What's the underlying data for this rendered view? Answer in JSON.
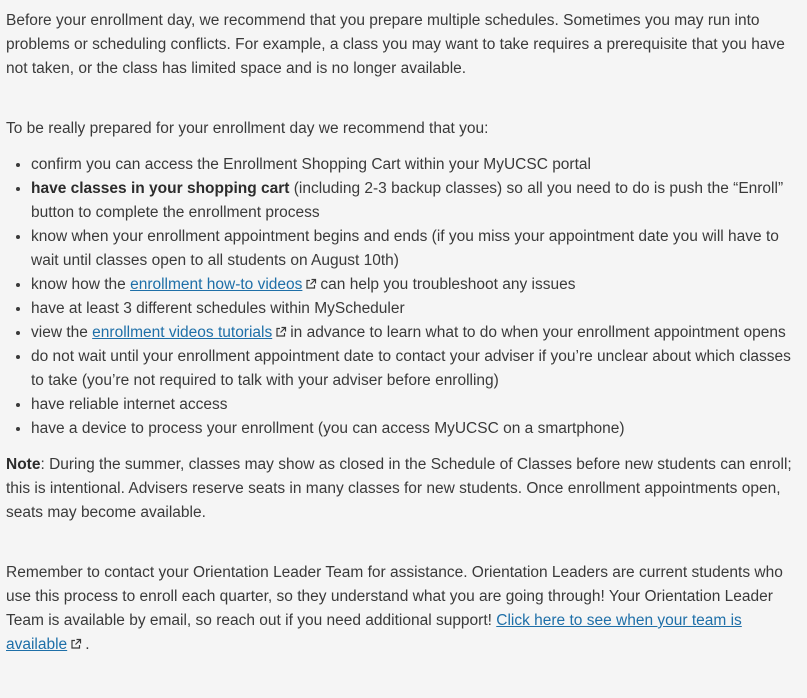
{
  "intro": "Before your enrollment day, we recommend that you prepare multiple schedules. Sometimes you may run into problems or scheduling conflicts. For example, a class you may want to take requires a prerequisite that you have not taken, or the class has limited space and is no longer available.",
  "lead_in": "To be really prepared for your enrollment day we recommend that you:",
  "list": {
    "item1": "confirm you can access the Enrollment Shopping Cart within your MyUCSC portal",
    "item2_bold": "have classes in your shopping cart",
    "item2_rest": " (including 2-3 backup classes) so all you need to do is push the “Enroll” button to complete the enrollment process",
    "item3": "know when your enrollment appointment begins and ends (if you miss your appointment date you will have to wait until classes open to all students on August 10th)",
    "item4_before": "know how the ",
    "item4_link": "enrollment how-to videos",
    "item4_after": "can help you troubleshoot any issues",
    "item5": "have at least 3 different schedules within MyScheduler",
    "item6_before": "view the ",
    "item6_link": "enrollment videos tutorials",
    "item6_after": "in advance to learn what to do when your enrollment appointment opens",
    "item7": "do not wait until your enrollment appointment date to contact your adviser if you’re unclear about which classes to take (you’re not required to talk with your adviser before enrolling)",
    "item8": "have reliable internet access",
    "item9": "have a device to process your enrollment (you can access MyUCSC on a smartphone)"
  },
  "note": {
    "label": "Note",
    "text": ": During the summer, classes may show as closed in the Schedule of Classes before new students can enroll; this is intentional. Advisers reserve seats in many classes for new students. Once enrollment appointments open, seats may become available."
  },
  "closing": {
    "text": "Remember to contact your Orientation Leader Team for assistance. Orientation Leaders are current students who use this process to enroll each quarter, so they understand what you are going through! Your Orientation Leader Team is available by email, so reach out if you need additional support! ",
    "link": "Click here to see when your team is available",
    "end": "."
  },
  "icons": {
    "external_link": "external-link-icon"
  },
  "colors": {
    "text": "#3a3a3a",
    "link": "#1e6fa8",
    "background": "#f5f5f5"
  }
}
